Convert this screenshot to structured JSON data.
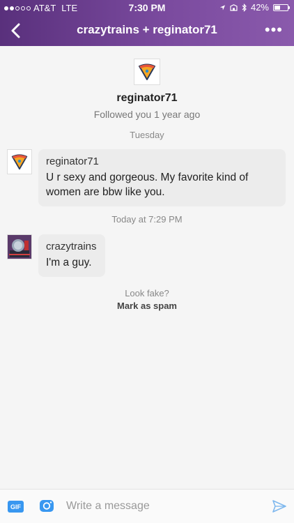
{
  "status_bar": {
    "carrier": "AT&T",
    "network": "LTE",
    "time": "7:30 PM",
    "battery": "42%",
    "battery_level": 0.42
  },
  "nav": {
    "title": "crazytrains + reginator71",
    "more": "•••"
  },
  "profile": {
    "username": "reginator71",
    "followed_text": "Followed you 1 year ago"
  },
  "thread": {
    "day_1": "Tuesday",
    "message_1": {
      "sender": "reginator71",
      "text": "U r sexy and gorgeous. My favorite kind of women are bbw like you."
    },
    "day_2": "Today at 7:29 PM",
    "message_2": {
      "sender": "crazytrains",
      "text": "I'm a guy."
    }
  },
  "spam": {
    "question": "Look fake?",
    "action": "Mark as spam"
  },
  "composer": {
    "gif_label": "GIF",
    "placeholder": "Write a message"
  },
  "colors": {
    "header_start": "#59307c",
    "header_end": "#8a5aac",
    "accent_blue": "#3897f0"
  }
}
